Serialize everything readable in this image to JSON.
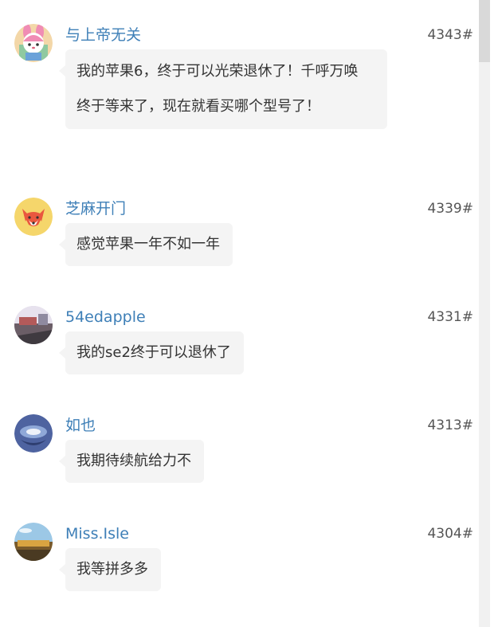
{
  "comments": [
    {
      "username": "与上帝无关",
      "floor": "4343#",
      "text": "我的苹果6，终于可以光荣退休了！千呼万唤终于等来了，现在就看买哪个型号了！",
      "avatar_icon": "pink-bunny-avatar-icon"
    },
    {
      "username": "芝麻开门",
      "floor": "4339#",
      "text": "感觉苹果一年不如一年",
      "avatar_icon": "fox-avatar-icon"
    },
    {
      "username": "54edapple",
      "floor": "4331#",
      "text": "我的se2终于可以退休了",
      "avatar_icon": "photo-avatar-icon"
    },
    {
      "username": "如也",
      "floor": "4313#",
      "text": "我期待续航给力不",
      "avatar_icon": "blue-swirl-avatar-icon"
    },
    {
      "username": "Miss.Isle",
      "floor": "4304#",
      "text": "我等拼多多",
      "avatar_icon": "landscape-avatar-icon"
    }
  ],
  "colors": {
    "username": "#3e7fb7",
    "bubble_bg": "#f4f4f4",
    "text": "#333333",
    "floor": "#555555"
  }
}
